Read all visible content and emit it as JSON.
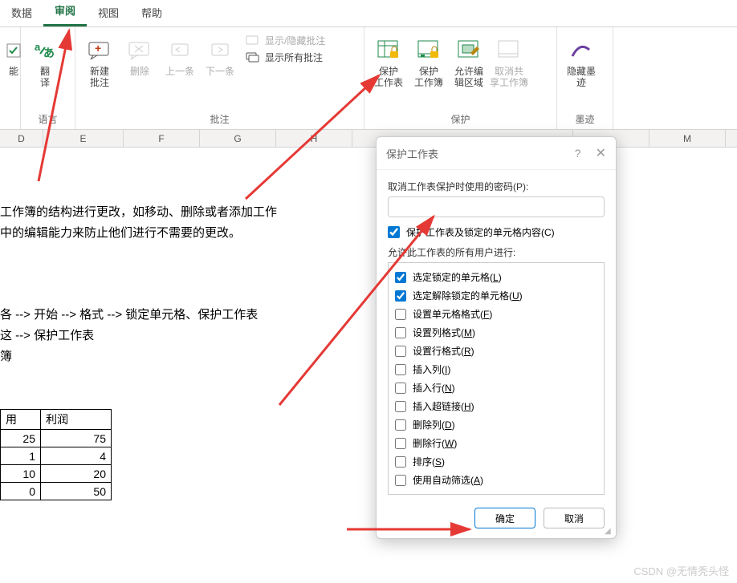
{
  "tabs": {
    "data": "数据",
    "review": "审阅",
    "view": "视图",
    "help": "帮助",
    "active": "审阅"
  },
  "ribbon": {
    "group_partial": {
      "btn": "能",
      "label": ""
    },
    "lang": {
      "translate": "翻\n译",
      "label": "语言"
    },
    "comments": {
      "new": "新建\n批注",
      "delete": "删除",
      "prev": "上一条",
      "next": "下一条",
      "show_hide": "显示/隐藏批注",
      "show_all": "显示所有批注",
      "label": "批注"
    },
    "protect": {
      "protect_sheet": "保护\n工作表",
      "protect_workbook": "保护\n工作簿",
      "allow_edit": "允许编\n辑区域",
      "unshare": "取消共\n享工作簿",
      "label": "保护"
    },
    "ink": {
      "hide": "隐藏墨\n迹",
      "label": "墨迹"
    }
  },
  "columns": {
    "D": "D",
    "E": "E",
    "F": "F",
    "G": "G",
    "H": "H",
    "M": "M"
  },
  "sheet_text": {
    "l1": "工作簿的结构进行更改，如移动、删除或者添加工作",
    "l2": "中的编辑能力来防止他们进行不需要的更改。",
    "l3": "各 --> 开始 --> 格式 --> 锁定单元格、保护工作表",
    "l4": "这 --> 保护工作表",
    "l5": "簿"
  },
  "table": {
    "h1": "用",
    "h2": "利润",
    "rows": [
      [
        "25",
        "75"
      ],
      [
        "1",
        "4"
      ],
      [
        "10",
        "20"
      ],
      [
        "0",
        "50"
      ]
    ]
  },
  "dialog": {
    "title": "保护工作表",
    "password_label": "取消工作表保护时使用的密码(P):",
    "password_value": "",
    "protect_contents": "保护工作表及锁定的单元格内容(C)",
    "allow_label": "允许此工作表的所有用户进行:",
    "perms": [
      {
        "checked": true,
        "label": "选定锁定的单元格(",
        "u": "L",
        "tail": ")"
      },
      {
        "checked": true,
        "label": "选定解除锁定的单元格(",
        "u": "U",
        "tail": ")"
      },
      {
        "checked": false,
        "label": "设置单元格格式(",
        "u": "F",
        "tail": ")"
      },
      {
        "checked": false,
        "label": "设置列格式(",
        "u": "M",
        "tail": ")"
      },
      {
        "checked": false,
        "label": "设置行格式(",
        "u": "R",
        "tail": ")"
      },
      {
        "checked": false,
        "label": "插入列(",
        "u": "I",
        "tail": ")"
      },
      {
        "checked": false,
        "label": "插入行(",
        "u": "N",
        "tail": ")"
      },
      {
        "checked": false,
        "label": "插入超链接(",
        "u": "H",
        "tail": ")"
      },
      {
        "checked": false,
        "label": "删除列(",
        "u": "D",
        "tail": ")"
      },
      {
        "checked": false,
        "label": "删除行(",
        "u": "W",
        "tail": ")"
      },
      {
        "checked": false,
        "label": "排序(",
        "u": "S",
        "tail": ")"
      },
      {
        "checked": false,
        "label": "使用自动筛选(",
        "u": "A",
        "tail": ")"
      }
    ],
    "ok": "确定",
    "cancel": "取消"
  },
  "watermark": "CSDN @无情秃头怪"
}
